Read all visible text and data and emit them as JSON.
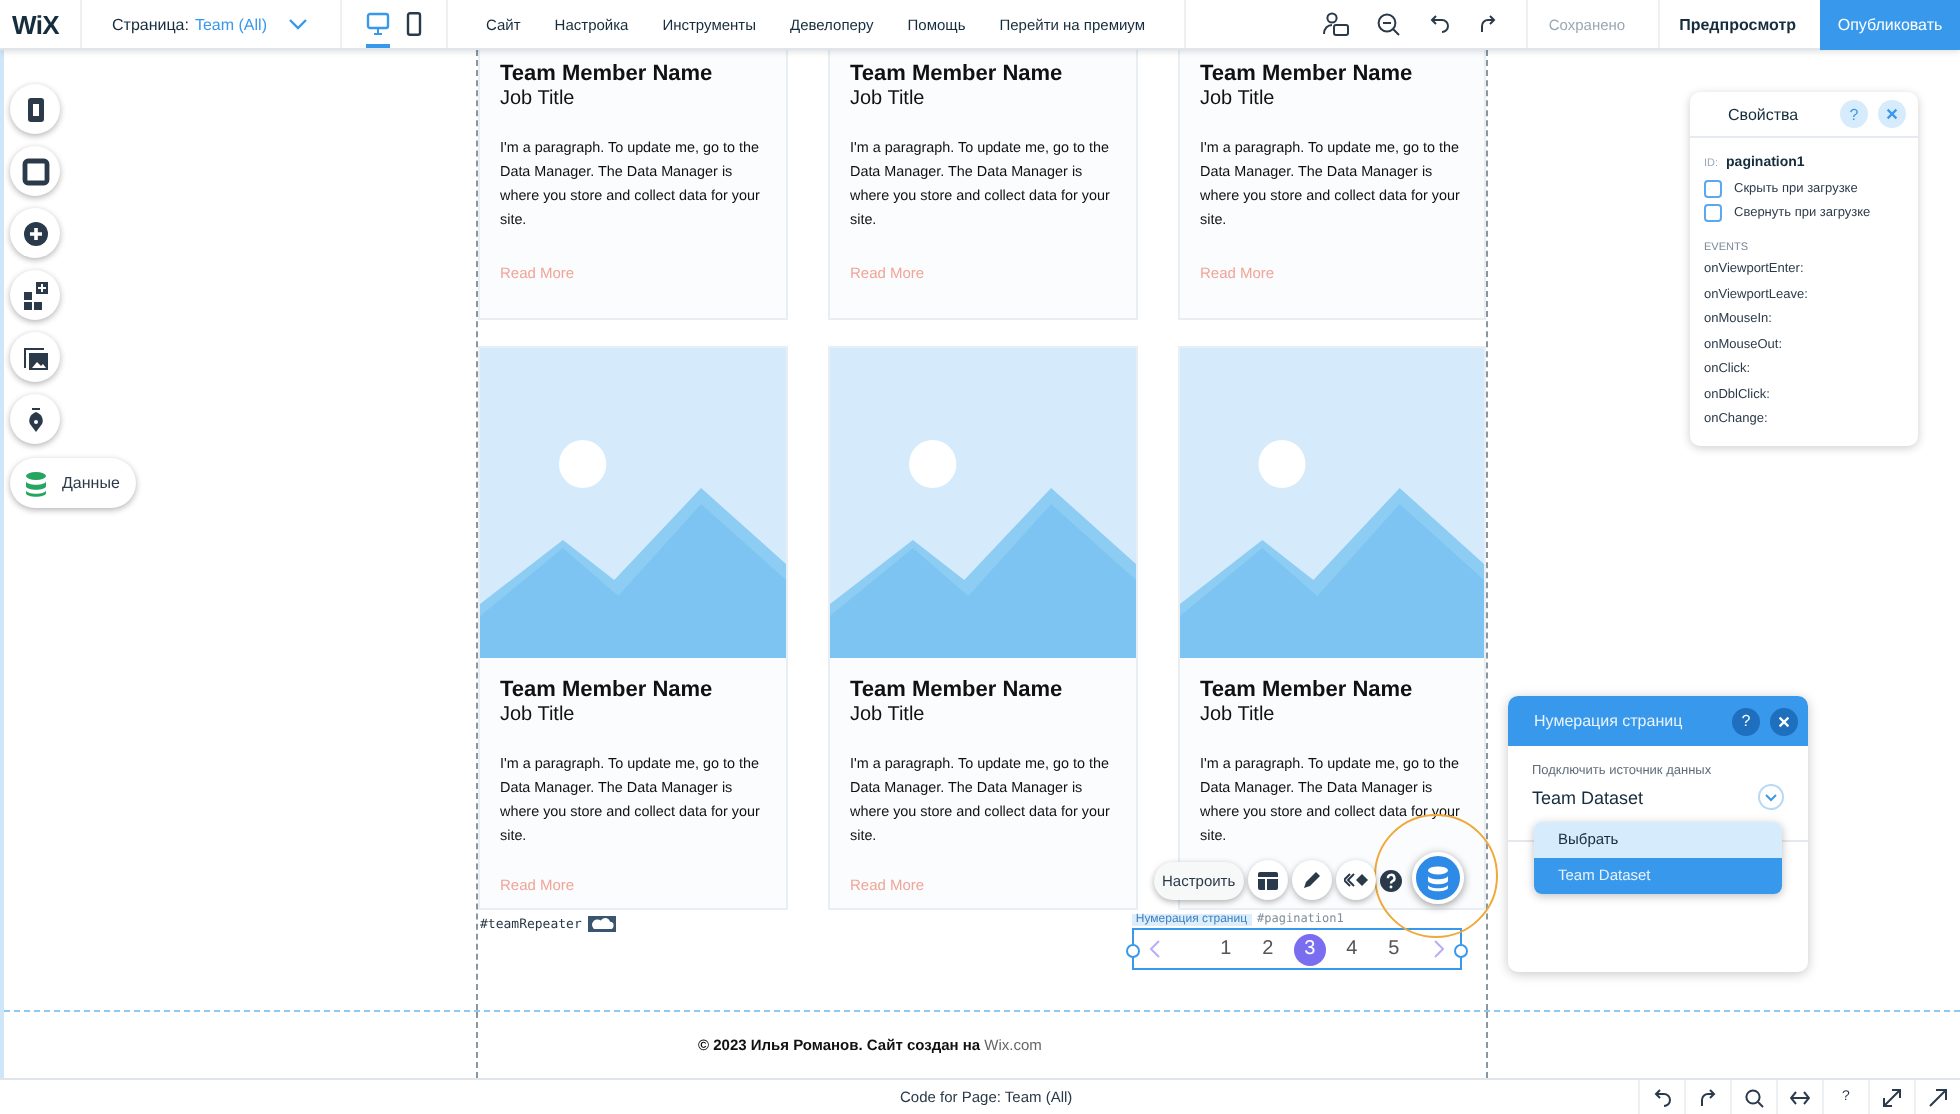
{
  "top_bar": {
    "logo": "WiX",
    "page_label": "Страница:",
    "page_name": "Team (All)",
    "devices": [
      {
        "kind": "desktop",
        "selected": true
      },
      {
        "kind": "mobile",
        "selected": false
      }
    ],
    "menu": [
      "Сайт",
      "Настройка",
      "Инструменты",
      "Девелоперу",
      "Помощь",
      "Перейти на премиум"
    ],
    "saved_status": "Сохранено",
    "preview": "Предпросмотр",
    "publish": "Опубликовать"
  },
  "left_tools": [
    {
      "kind": "pages"
    },
    {
      "kind": "background"
    },
    {
      "kind": "add"
    },
    {
      "kind": "apps"
    },
    {
      "kind": "media"
    },
    {
      "kind": "blog"
    },
    {
      "kind": "data",
      "label": "Данные"
    }
  ],
  "repeater": {
    "tag": "#teamRepeater",
    "items": [
      {
        "kind": "cropped",
        "name": "Team Member Name",
        "job_title": "Job Title",
        "paragraph": "I'm a paragraph. To update me, go to the Data Manager. The Data Manager is where you store and collect data for your site.",
        "link": "Read More"
      },
      {
        "kind": "cropped",
        "name": "Team Member Name",
        "job_title": "Job Title",
        "paragraph": "I'm a paragraph. To update me, go to the Data Manager. The Data Manager is where you store and collect data for your site.",
        "link": "Read More"
      },
      {
        "kind": "cropped",
        "name": "Team Member Name",
        "job_title": "Job Title",
        "paragraph": "I'm a paragraph. To update me, go to the Data Manager. The Data Manager is where you store and collect data for your site.",
        "link": "Read More"
      },
      {
        "kind": "full",
        "name": "Team Member Name",
        "job_title": "Job Title",
        "paragraph": "I'm a paragraph. To update me, go to the Data Manager. The Data Manager is where you store and collect data for your site.",
        "link": "Read More"
      },
      {
        "kind": "full",
        "name": "Team Member Name",
        "job_title": "Job Title",
        "paragraph": "I'm a paragraph. To update me, go to the Data Manager. The Data Manager is where you store and collect data for your site.",
        "link": "Read More"
      },
      {
        "kind": "full",
        "name": "Team Member Name",
        "job_title": "Job Title",
        "paragraph": "I'm a paragraph. To update me, go to the Data Manager. The Data Manager is where you store and collect data for your site."
      }
    ]
  },
  "pagination": {
    "label": "Нумерация страниц",
    "id_tag": "#pagination1",
    "pages": [
      {
        "label": "1",
        "selected": false
      },
      {
        "label": "2",
        "selected": false
      },
      {
        "label": "3",
        "selected": true
      },
      {
        "label": "4",
        "selected": false
      },
      {
        "label": "5",
        "selected": false
      }
    ]
  },
  "element_toolbar": {
    "settings_button": "Настроить"
  },
  "properties_panel": {
    "title": "Свойства",
    "help": "?",
    "id_label": "ID:",
    "id_value": "pagination1",
    "options": [
      {
        "label": "Скрыть при загрузке",
        "checked": false
      },
      {
        "label": "Свернуть при загрузке",
        "checked": false
      }
    ],
    "events_heading": "EVENTS",
    "events": [
      "onViewportEnter:",
      "onViewportLeave:",
      "onMouseIn:",
      "onMouseOut:",
      "onClick:",
      "onDblClick:",
      "onChange:"
    ]
  },
  "pagination_panel": {
    "title": "Нумерация страниц",
    "help": "?",
    "field_label": "Подключить источник данных",
    "field_value": "Team Dataset",
    "options": [
      {
        "label": "Выбрать",
        "hovered": true,
        "selected": false
      },
      {
        "label": "Team Dataset",
        "hovered": false,
        "selected": true
      }
    ]
  },
  "footer": {
    "text": "© 2023 Илья Романов. Сайт создан на ",
    "link": "Wix.com"
  },
  "code_bar": {
    "title": "Code for Page: Team (All)",
    "help": "?"
  }
}
